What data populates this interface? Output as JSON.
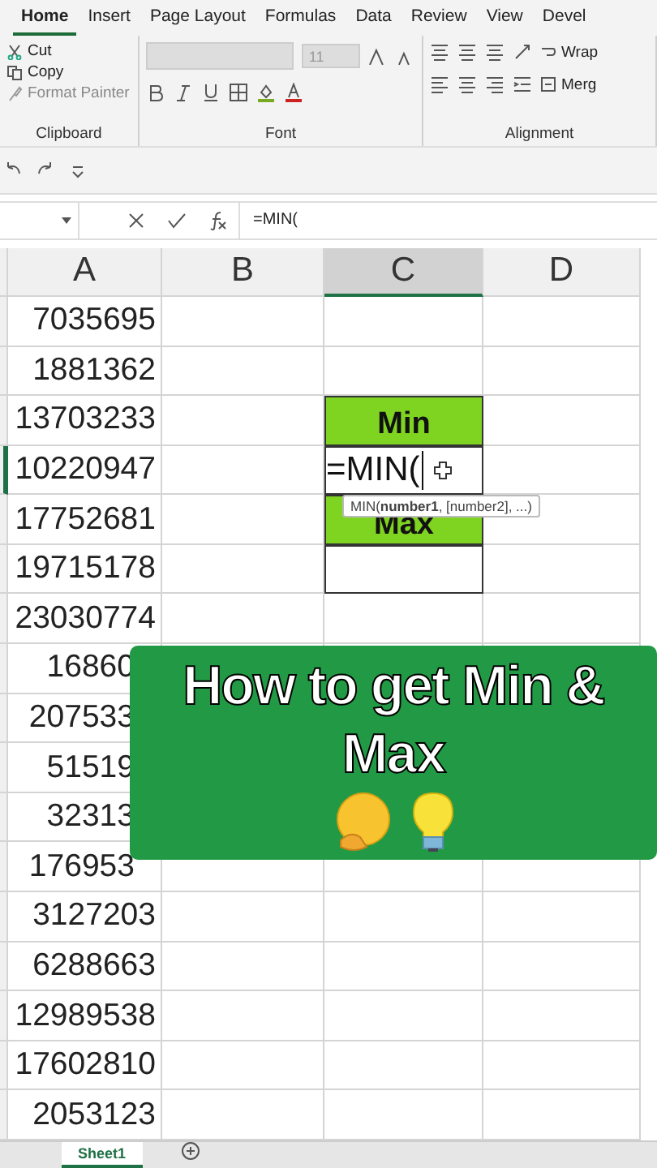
{
  "ribbon_tabs": [
    {
      "label": "Home",
      "selected": true
    },
    {
      "label": "Insert",
      "selected": false
    },
    {
      "label": "Page Layout",
      "selected": false
    },
    {
      "label": "Formulas",
      "selected": false
    },
    {
      "label": "Data",
      "selected": false
    },
    {
      "label": "Review",
      "selected": false
    },
    {
      "label": "View",
      "selected": false
    },
    {
      "label": "Devel",
      "selected": false
    }
  ],
  "clipboard": {
    "cut": "Cut",
    "copy": "Copy",
    "format_painter": "Format Painter",
    "label": "Clipboard"
  },
  "font": {
    "size": "11",
    "label": "Font"
  },
  "alignment": {
    "wrap": "Wrap",
    "merge": "Merg",
    "label": "Alignment"
  },
  "formula_bar": {
    "value": "=MIN("
  },
  "columns": [
    {
      "label": "A",
      "selected": false
    },
    {
      "label": "B",
      "selected": false
    },
    {
      "label": "C",
      "selected": true
    },
    {
      "label": "D",
      "selected": false
    }
  ],
  "rows": [
    {
      "a": "7035695",
      "selected": false,
      "c": {
        "kind": "empty"
      }
    },
    {
      "a": "1881362",
      "selected": false,
      "c": {
        "kind": "empty"
      }
    },
    {
      "a": "13703233",
      "selected": false,
      "c": {
        "kind": "header",
        "text": "Min"
      }
    },
    {
      "a": "10220947",
      "selected": true,
      "c": {
        "kind": "editing",
        "text": "=MIN("
      }
    },
    {
      "a": "17752681",
      "selected": false,
      "c": {
        "kind": "header",
        "text": "Max"
      }
    },
    {
      "a": "19715178",
      "selected": false,
      "c": {
        "kind": "boxed"
      }
    },
    {
      "a": "23030774",
      "selected": false,
      "c": {
        "kind": "empty"
      }
    },
    {
      "a": "16860",
      "selected": false,
      "c": {
        "kind": "empty"
      }
    },
    {
      "a": "207533",
      "selected": false,
      "c": {
        "kind": "empty"
      }
    },
    {
      "a": "51519",
      "selected": false,
      "c": {
        "kind": "empty"
      }
    },
    {
      "a": "32313",
      "selected": false,
      "c": {
        "kind": "empty"
      }
    },
    {
      "a": "176953",
      "selected": false,
      "c": {
        "kind": "empty"
      }
    },
    {
      "a": "3127203",
      "selected": false,
      "c": {
        "kind": "empty"
      }
    },
    {
      "a": "6288663",
      "selected": false,
      "c": {
        "kind": "empty"
      }
    },
    {
      "a": "12989538",
      "selected": false,
      "c": {
        "kind": "empty"
      }
    },
    {
      "a": "17602810",
      "selected": false,
      "c": {
        "kind": "empty"
      }
    },
    {
      "a": "2053123",
      "selected": false,
      "c": {
        "kind": "empty"
      }
    }
  ],
  "tooltip": "MIN(**number1**, [number2], ...)",
  "overlay": {
    "title": "How to get Min & Max"
  },
  "sheet_tabs": [
    {
      "label": "Sheet1",
      "selected": true
    }
  ]
}
